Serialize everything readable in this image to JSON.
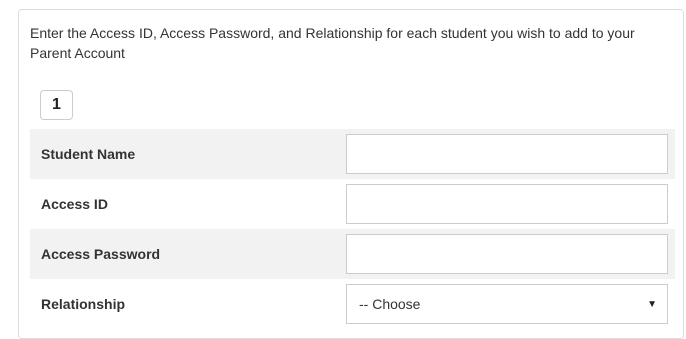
{
  "instructions": "Enter the Access ID, Access Password, and Relationship for each student you wish to add to your Parent Account",
  "student_number": "1",
  "fields": {
    "student_name": {
      "label": "Student Name",
      "value": ""
    },
    "access_id": {
      "label": "Access ID",
      "value": ""
    },
    "access_password": {
      "label": "Access Password",
      "value": ""
    },
    "relationship": {
      "label": "Relationship",
      "selected": "-- Choose"
    }
  },
  "icons": {
    "dropdown": "caret-down-icon"
  },
  "colors": {
    "shaded_row": "#f2f2f2",
    "border": "#dddddd",
    "input_border": "#cccccc",
    "text": "#333333"
  }
}
